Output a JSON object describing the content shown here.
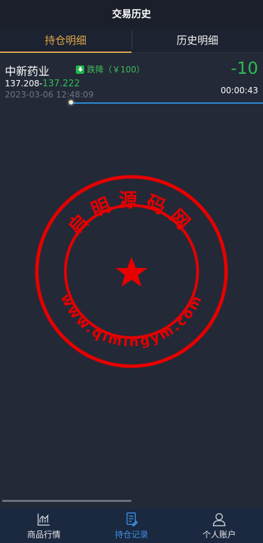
{
  "header": {
    "title": "交易历史"
  },
  "tabs": [
    {
      "label": "持仓明细",
      "active": true
    },
    {
      "label": "历史明细",
      "active": false
    }
  ],
  "position": {
    "name": "中新药业",
    "badge_label": "跌降（￥100）",
    "change": "-10",
    "open_price": "137.208",
    "separator": "-",
    "current_price": "137.222",
    "timestamp": "2023-03-06 12:48:09",
    "countdown": "00:00:43",
    "progress": 0.27
  },
  "watermark": {
    "top_text": "启明源码网",
    "bottom_text": "www.qimingym.com",
    "color": "#e60000"
  },
  "bottom_nav": [
    {
      "label": "商品行情",
      "icon": "chart-icon",
      "active": false
    },
    {
      "label": "持仓记录",
      "icon": "document-icon",
      "active": true
    },
    {
      "label": "个人账户",
      "icon": "user-icon",
      "active": false
    }
  ],
  "colors": {
    "accent_tab": "#e0a84a",
    "down_green": "#2ebd52",
    "nav_active": "#3e8fe6",
    "background": "#232937"
  }
}
